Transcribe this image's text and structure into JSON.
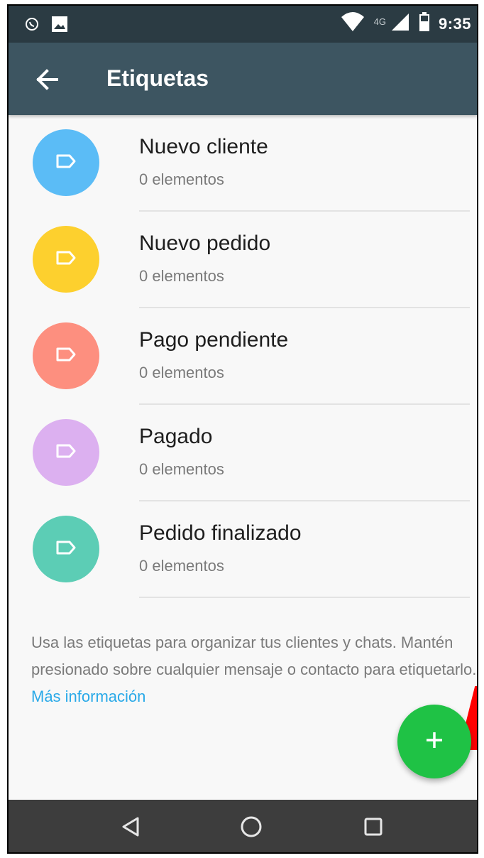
{
  "status_bar": {
    "time": "9:35",
    "network": "4G",
    "icons": [
      "whatsapp-icon",
      "image-icon",
      "wifi-icon",
      "signal-icon",
      "battery-icon"
    ]
  },
  "app_bar": {
    "title": "Etiquetas",
    "back_icon": "arrow-back-icon"
  },
  "labels": [
    {
      "name": "Nuevo cliente",
      "count": "0 elementos",
      "color": "#5bbcf6"
    },
    {
      "name": "Nuevo pedido",
      "count": "0 elementos",
      "color": "#fdd02e"
    },
    {
      "name": "Pago pendiente",
      "count": "0 elementos",
      "color": "#fd8f7f"
    },
    {
      "name": "Pagado",
      "count": "0 elementos",
      "color": "#dcb0f0"
    },
    {
      "name": "Pedido finalizado",
      "count": "0 elementos",
      "color": "#5ccdb5"
    }
  ],
  "info": {
    "text": "Usa las etiquetas para organizar tus clientes y chats. Mantén presionado sobre cualquier mensaje o contacto para etiquetarlo. ",
    "link": "Más información"
  },
  "fab": {
    "icon": "plus-icon",
    "color": "#1fc245"
  },
  "nav_bar": {
    "icons": [
      "back-triangle-icon",
      "home-circle-icon",
      "recents-square-icon"
    ]
  }
}
